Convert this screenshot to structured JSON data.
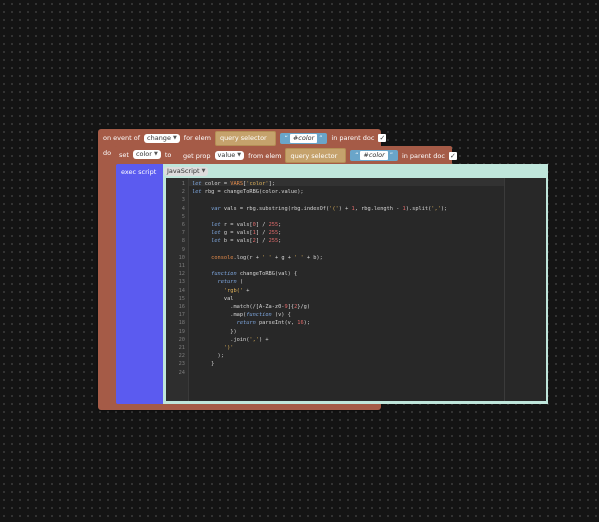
{
  "event_block": {
    "label_prefix": "on event of",
    "event_value": "change",
    "label_for_elem": "for elem",
    "query_selector_label": "query selector",
    "selector_value": "#color",
    "label_in_parent": "in parent doc"
  },
  "do_label": "do",
  "set_block": {
    "label_set": "set",
    "var_value": "color",
    "label_to": "to",
    "get_prop_label": "get prop",
    "prop_value": "value",
    "label_from_elem": "from elem",
    "query_selector_label": "query selector",
    "selector_value": "#color",
    "label_in_parent": "in parent doc"
  },
  "exec_block": {
    "label": "exec script",
    "language": "JavaScript"
  },
  "editor": {
    "line_numbers": [
      "1",
      "2",
      "3",
      "4",
      "5",
      "6",
      "7",
      "8",
      "9",
      "10",
      "11",
      "12",
      "13",
      "14",
      "15",
      "16",
      "17",
      "18",
      "19",
      "20",
      "21",
      "22",
      "23",
      "24"
    ],
    "lines": [
      "let color = VARS['color'];",
      "let rbg = changeToRBG(color.value);",
      "",
      "      var vals = rbg.substring(rbg.indexOf('(') + 1, rbg.length - 1).split(',');",
      "",
      "      let r = vals[0] / 255;",
      "      let g = vals[1] / 255;",
      "      let b = vals[2] / 255;",
      "",
      "      console.log(r + ' ' + g + ' ' + b);",
      "",
      "      function changeToRBG(val) {",
      "        return (",
      "          'rgb(' +",
      "          val",
      "            .match(/[A-Za-z0-9]{2}/g)",
      "            .map(function (v) {",
      "              return parseInt(v, 16);",
      "            })",
      "            .join(',') +",
      "          ')'",
      "        );",
      "      }",
      ""
    ]
  }
}
